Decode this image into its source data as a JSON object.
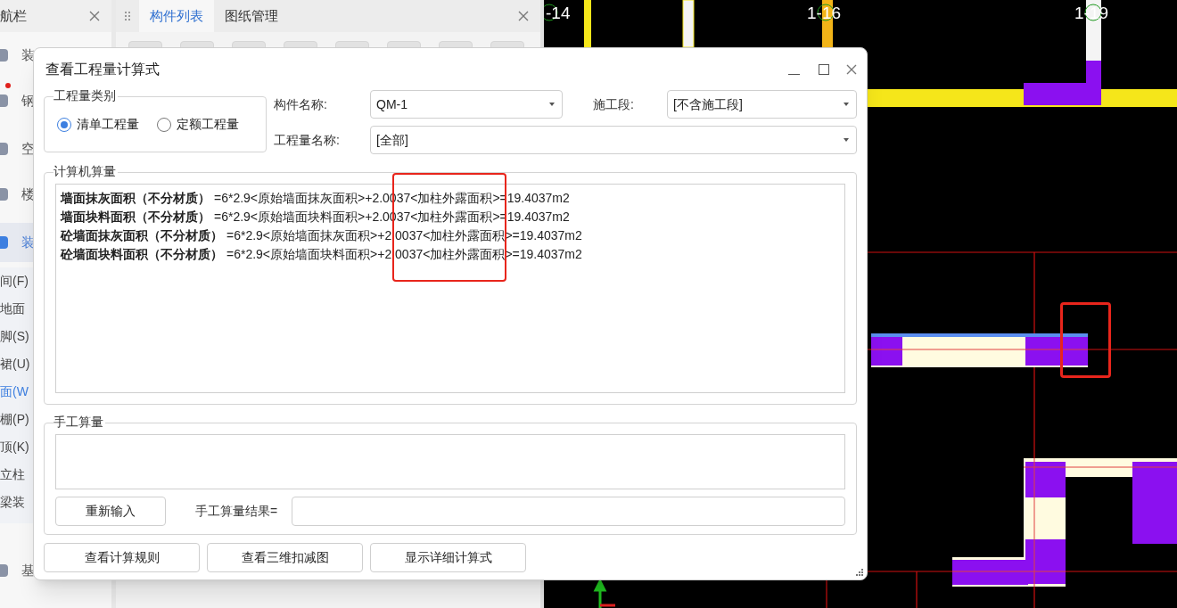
{
  "nav_panel": {
    "title": "航栏",
    "categories": [
      {
        "label": "装",
        "selected": false,
        "alert": false
      },
      {
        "label": "钢",
        "selected": false,
        "alert": true
      },
      {
        "label": "空",
        "selected": false,
        "alert": false
      },
      {
        "label": "楼",
        "selected": false,
        "alert": false
      },
      {
        "label": "装",
        "selected": true,
        "alert": false
      }
    ],
    "items": [
      {
        "label": "间(F)",
        "selected": false
      },
      {
        "label": "地面",
        "selected": false
      },
      {
        "label": "脚(S)",
        "selected": false
      },
      {
        "label": "裙(U)",
        "selected": false
      },
      {
        "label": "面(W",
        "selected": true
      },
      {
        "label": "棚(P)",
        "selected": false
      },
      {
        "label": "顶(K)",
        "selected": false
      },
      {
        "label": "立柱",
        "selected": false
      },
      {
        "label": "梁装",
        "selected": false
      }
    ],
    "footer_category": {
      "label": "基",
      "selected": false
    }
  },
  "middle_panel": {
    "tabs": [
      {
        "label": "构件列表",
        "selected": true
      },
      {
        "label": "图纸管理",
        "selected": false
      }
    ]
  },
  "drawing": {
    "axis_labels": [
      "-14",
      "1-16",
      "1-19"
    ]
  },
  "dialog": {
    "title": "查看工程量计算式",
    "quantity_type": {
      "legend": "工程量类别",
      "options": [
        {
          "label": "清单工程量",
          "selected": true
        },
        {
          "label": "定额工程量",
          "selected": false
        }
      ]
    },
    "component_name": {
      "label": "构件名称:",
      "value": "QM-1"
    },
    "construction_stage": {
      "label": "施工段:",
      "value": "[不含施工段]"
    },
    "quantity_name": {
      "label": "工程量名称:",
      "value": "[全部]"
    },
    "computed": {
      "legend": "计算机算量",
      "lines": [
        {
          "name": "墙面抹灰面积（不分材质）",
          "formula": "=6*2.9<原始墙面抹灰面积>+2.0037<加柱外露面积>=19.4037m2"
        },
        {
          "name": "墙面块料面积（不分材质）",
          "formula": "=6*2.9<原始墙面块料面积>+2.0037<加柱外露面积>=19.4037m2"
        },
        {
          "name": "砼墙面抹灰面积（不分材质）",
          "formula": "=6*2.9<原始墙面抹灰面积>+2.0037<加柱外露面积>=19.4037m2"
        },
        {
          "name": "砼墙面块料面积（不分材质）",
          "formula": "=6*2.9<原始墙面块料面积>+2.0037<加柱外露面积>=19.4037m2"
        }
      ]
    },
    "manual": {
      "legend": "手工算量",
      "reset_button": "重新输入",
      "result_label": "手工算量结果="
    },
    "buttons": [
      "查看计算规则",
      "查看三维扣减图",
      "显示详细计算式"
    ]
  }
}
